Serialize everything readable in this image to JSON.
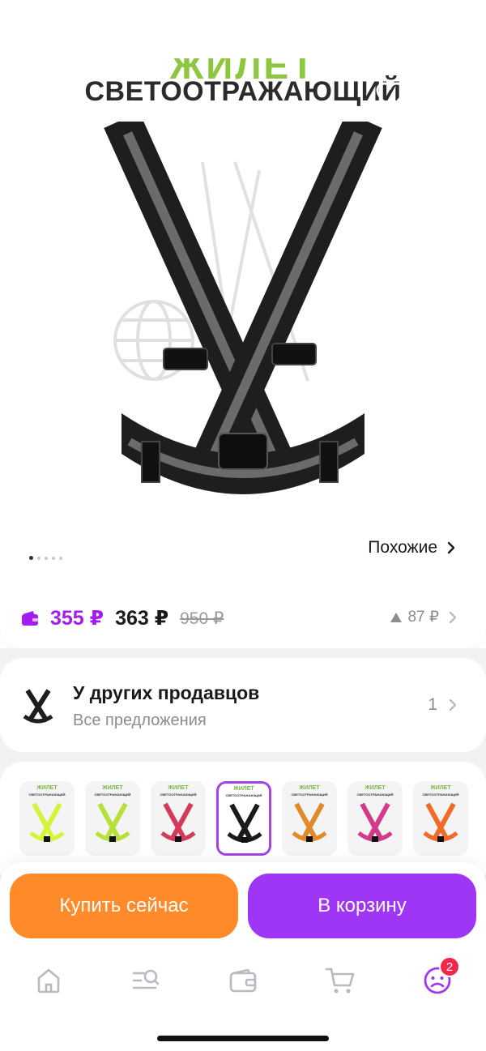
{
  "product": {
    "image_title_top": "ЖИЛЕТ",
    "image_title": "СВЕТООТРАЖАЮЩИЙ"
  },
  "gallery": {
    "similar_label": "Похожие",
    "dots_count": 5,
    "active_dot": 0
  },
  "price": {
    "wallet_price": "355 ₽",
    "price": "363 ₽",
    "old_price": "950 ₽",
    "delta": "87 ₽"
  },
  "other_sellers": {
    "title": "У других продавцов",
    "subtitle": "Все предложения",
    "count": "1"
  },
  "variants": {
    "items": [
      {
        "title": "ЖИЛЕТ",
        "subtitle": "СВЕТООТРАЖАЮЩИЙ",
        "color": "#d7f23a"
      },
      {
        "title": "ЖИЛЕТ",
        "subtitle": "СВЕТООТРАЖАЮЩИЙ",
        "color": "#b6e03a"
      },
      {
        "title": "ЖИЛЕТ",
        "subtitle": "СВЕТООТРАЖАЮЩИЙ",
        "color": "#d43a5a"
      },
      {
        "title": "ЖИЛЕТ",
        "subtitle": "СВЕТООТРАЖАЮЩИЙ",
        "color": "#1a1a1a"
      },
      {
        "title": "ЖИЛЕТ",
        "subtitle": "СВЕТООТРАЖАЮЩИЙ",
        "color": "#e08a2a"
      },
      {
        "title": "ЖИЛЕТ",
        "subtitle": "СВЕТООТРАЖАЮЩИЙ",
        "color": "#d43a8a"
      },
      {
        "title": "ЖИЛЕТ",
        "subtitle": "СВЕТООТРАЖАЮЩИЙ",
        "color": "#f06a2a"
      }
    ],
    "selected_index": 3
  },
  "actions": {
    "buy_now": "Купить сейчас",
    "add_to_cart": "В корзину"
  },
  "tabbar": {
    "profile_badge": "2"
  },
  "colors": {
    "accent_purple": "#a036f5",
    "buy_orange": "#ff8a2a",
    "wallet_price": "#a31cf0"
  }
}
